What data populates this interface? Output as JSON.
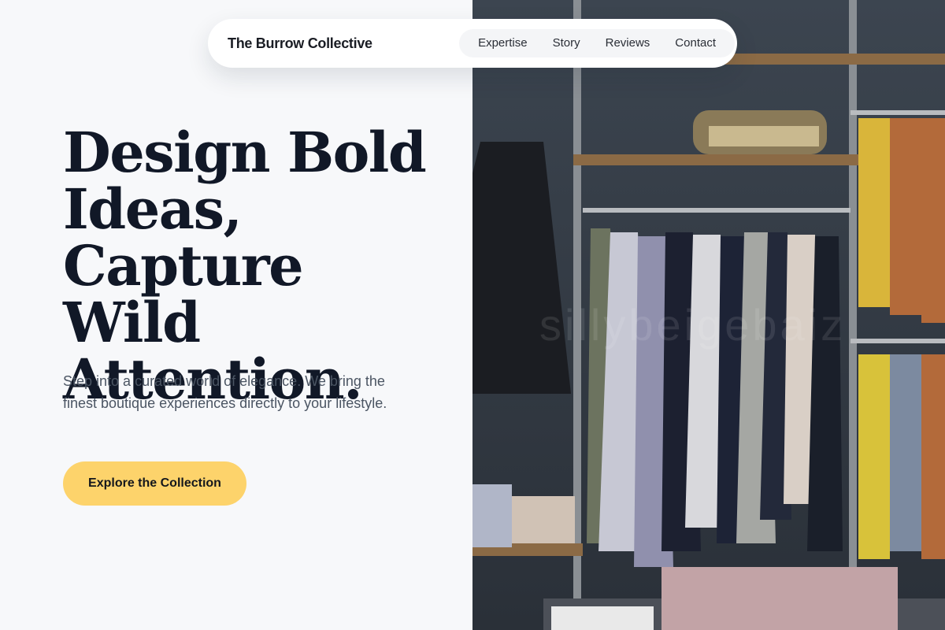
{
  "nav": {
    "brand": "The Burrow Collective",
    "links": [
      "Expertise",
      "Story",
      "Reviews",
      "Contact"
    ]
  },
  "hero": {
    "headline_lines": [
      "Design Bold",
      "Ideas,",
      "Capture Wild",
      "Attention."
    ],
    "subtext": "Step into a curated world of elegance. We bring the finest boutique experiences directly to your lifestyle.",
    "cta_label": "Explore the Collection"
  },
  "image": {
    "description_icon": "boutique-clothing-rack-photo",
    "watermark": "sillybeigebaiz"
  },
  "colors": {
    "background": "#f7f8fa",
    "headline": "#111827",
    "cta": "#fdd36b"
  }
}
